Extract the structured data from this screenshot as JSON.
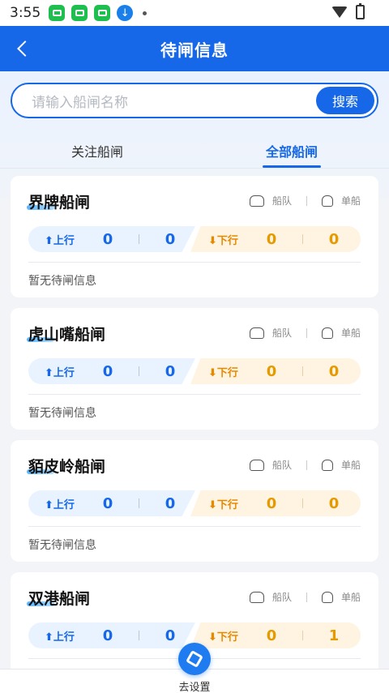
{
  "statusbar": {
    "time": "3:55"
  },
  "header": {
    "title": "待闸信息"
  },
  "search": {
    "placeholder": "请输入船闸名称",
    "button": "搜索"
  },
  "tabs": [
    {
      "label": "关注船闸",
      "active": false
    },
    {
      "label": "全部船闸",
      "active": true
    }
  ],
  "legend": {
    "fleet": "船队",
    "single": "单船"
  },
  "direction": {
    "up": "上行",
    "down": "下行"
  },
  "locks": [
    {
      "name": "界牌船闸",
      "up_fleet": "0",
      "up_single": "0",
      "down_fleet": "0",
      "down_single": "0",
      "info": "暂无待闸信息"
    },
    {
      "name": "虎山嘴船闸",
      "up_fleet": "0",
      "up_single": "0",
      "down_fleet": "0",
      "down_single": "0",
      "info": "暂无待闸信息"
    },
    {
      "name": "貊皮岭船闸",
      "up_fleet": "0",
      "up_single": "0",
      "down_fleet": "0",
      "down_single": "0",
      "info": "暂无待闸信息"
    },
    {
      "name": "双港船闸",
      "up_fleet": "0",
      "up_single": "0",
      "down_fleet": "0",
      "down_single": "1",
      "info": ""
    }
  ],
  "fab": {
    "label": "去设置"
  },
  "colors": {
    "primary": "#1668e8",
    "down": "#e59a00"
  }
}
